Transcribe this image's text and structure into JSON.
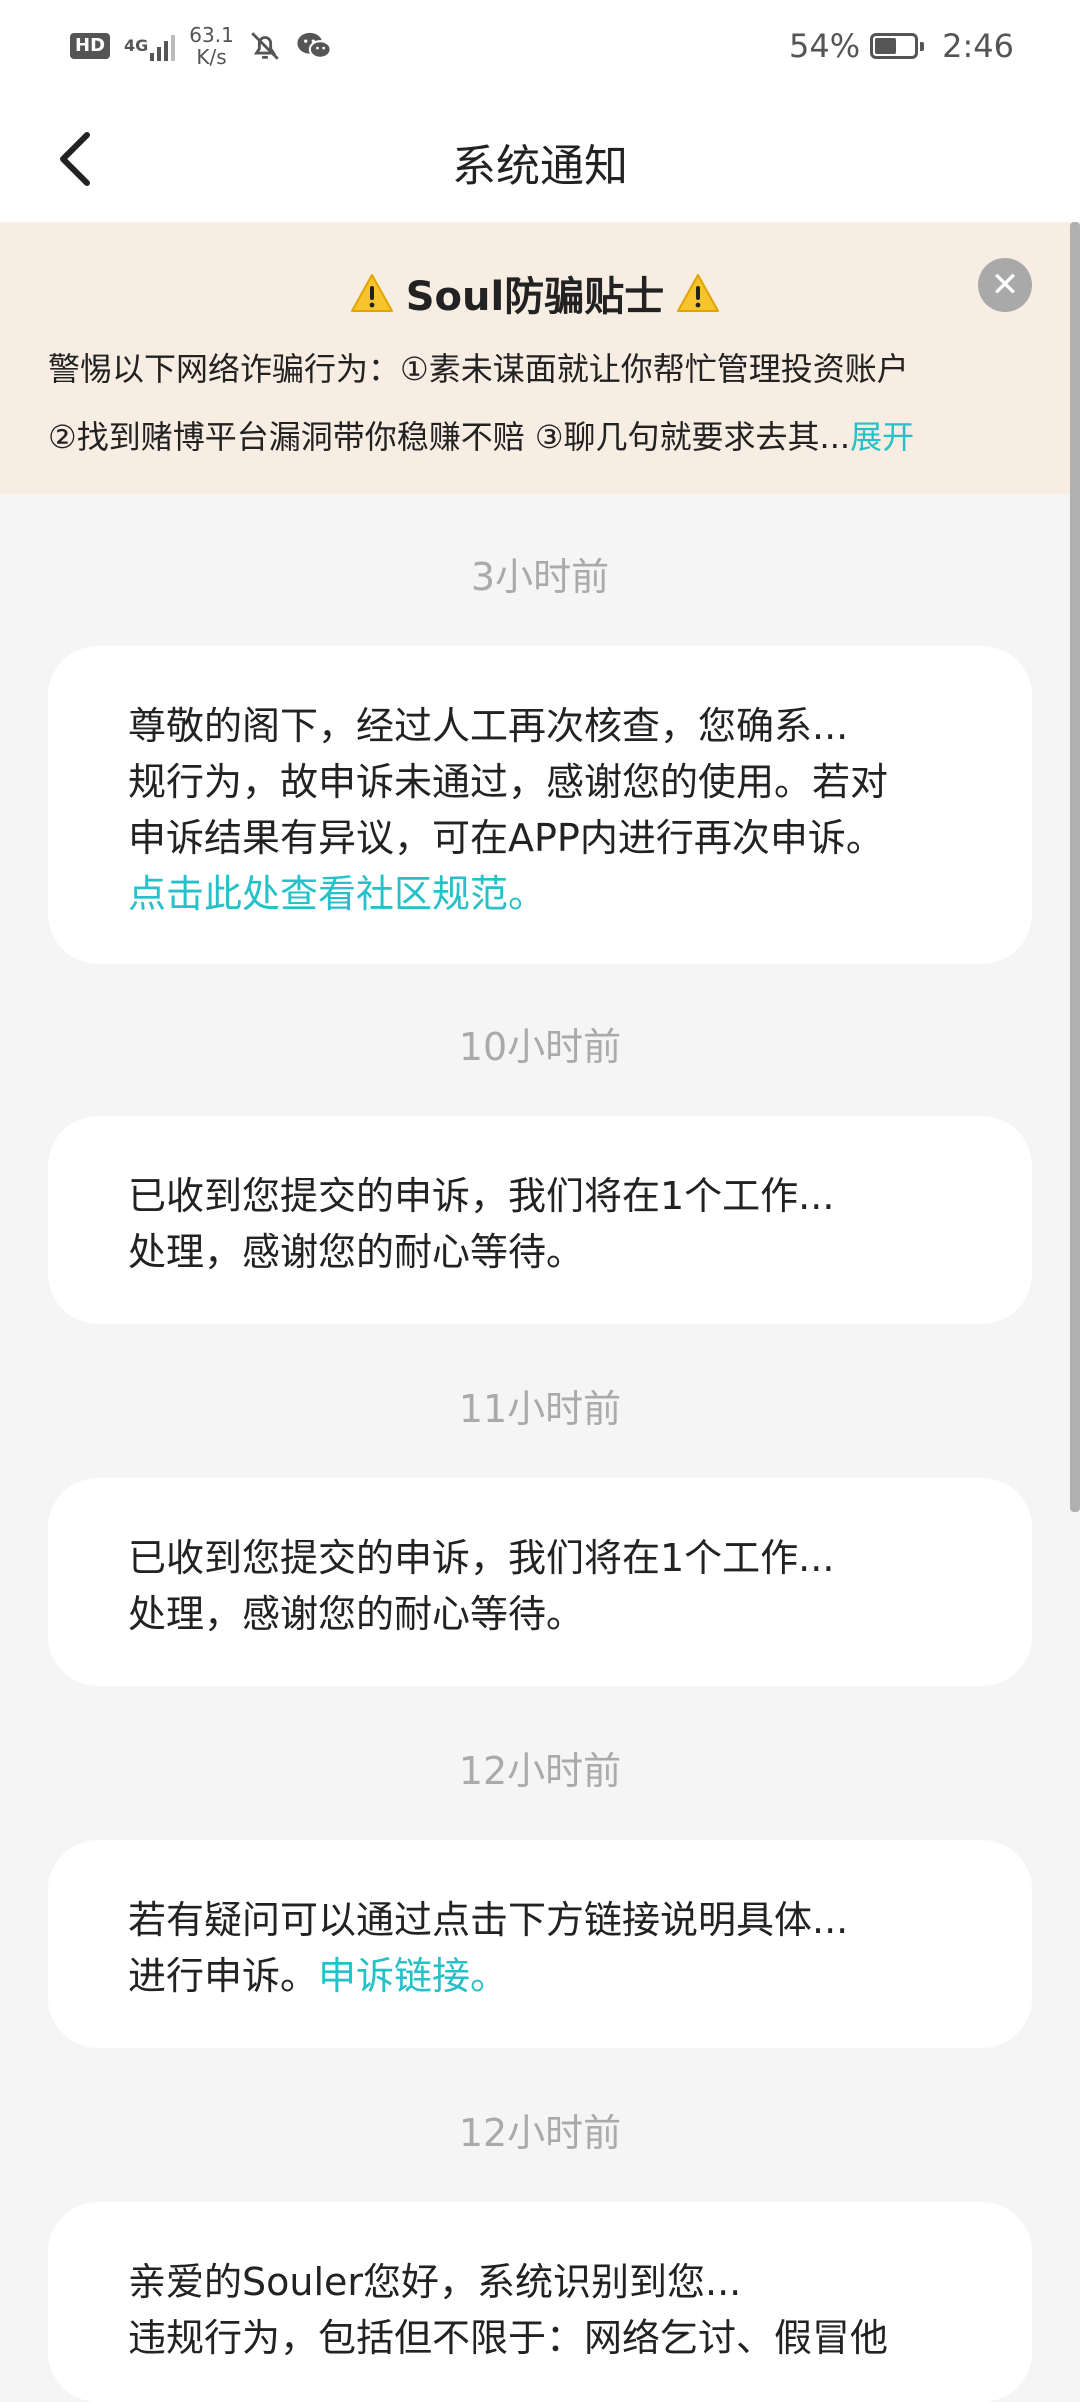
{
  "status_bar": {
    "hd": "HD",
    "network": "4G",
    "speed_value": "63.1",
    "speed_unit": "K/s",
    "battery": "54%",
    "battery_level": 0.54,
    "time": "2:46",
    "icons": [
      "hd-icon",
      "signal-icon",
      "mute-bell-icon",
      "wechat-icon",
      "battery-icon"
    ]
  },
  "header": {
    "title": "系统通知",
    "back_icon": "chevron-left-icon"
  },
  "notice": {
    "title": "Soul防骗贴士",
    "line1": "警惕以下网络诈骗行为：①素未谋面就让你帮忙管理投资账户",
    "line2": "②找到赌博平台漏洞带你稳赚不赔 ③聊几句就要求去其...",
    "expand": "展开",
    "accent_color": "#25c0c8",
    "background": "#f7ede3"
  },
  "messages": [
    {
      "time": "3小时前",
      "lines": [
        "尊敬的阁下，经过人工再次核查，您确系...",
        "规行为，故申诉未通过，感谢您的使用。若对",
        "申诉结果有异议，可在APP内进行再次申诉。"
      ],
      "link": "点击此处查看社区规范。"
    },
    {
      "time": "10小时前",
      "lines": [
        "已收到您提交的申诉，我们将在1个工作...",
        "处理，感谢您的耐心等待。"
      ]
    },
    {
      "time": "11小时前",
      "lines": [
        "已收到您提交的申诉，我们将在1个工作...",
        "处理，感谢您的耐心等待。"
      ]
    },
    {
      "time": "12小时前",
      "lines": [
        "若有疑问可以通过点击下方链接说明具体..."
      ],
      "line2_prefix": "进行申诉。",
      "link": "申诉链接。"
    },
    {
      "time": "12小时前",
      "lines": [
        "亲爱的Souler您好，系统识别到您...",
        "违规行为，包括但不限于：网络乞讨、假冒他"
      ]
    }
  ]
}
